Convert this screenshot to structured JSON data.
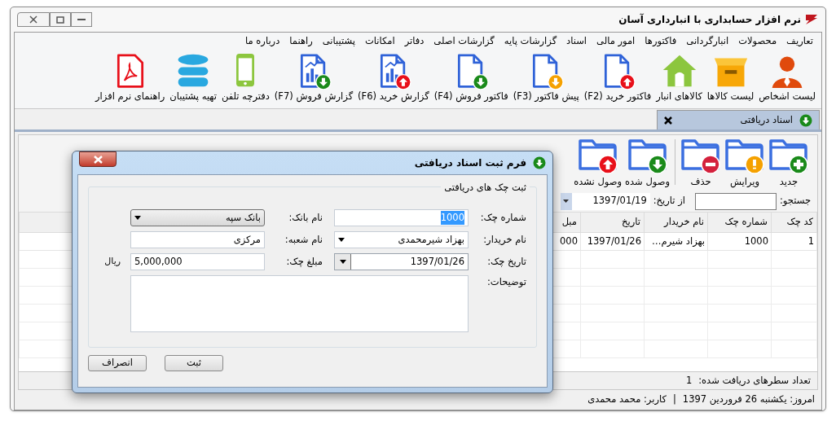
{
  "window": {
    "title": "نرم افزار حسابداری با انبارداری آسان"
  },
  "menu": [
    "تعاریف",
    "محصولات",
    "انبارگردانی",
    "فاکتورها",
    "امور مالی",
    "اسناد",
    "گزارشات پایه",
    "گزارشات اصلی",
    "دفاتر",
    "امکانات",
    "پشتیبانی",
    "راهنما",
    "درباره ما"
  ],
  "toolbar": [
    {
      "label": "لیست اشخاص",
      "kind": "person"
    },
    {
      "label": "لیست کالاها",
      "kind": "box"
    },
    {
      "label": "کالاهای انبار",
      "kind": "house"
    },
    {
      "label": "فاکتور خرید (F2)",
      "kind": "doc-up"
    },
    {
      "label": "پیش فاکتور (F3)",
      "kind": "doc-pending"
    },
    {
      "label": "فاکتور فروش (F4)",
      "kind": "doc-down"
    },
    {
      "label": "گزارش خرید (F6)",
      "kind": "chart-up"
    },
    {
      "label": "گزارش فروش (F7)",
      "kind": "chart-down"
    },
    {
      "label": "دفترچه تلفن",
      "kind": "phone"
    },
    {
      "label": "تهیه پشتیبان",
      "kind": "database"
    },
    {
      "label": "راهنمای نرم افزار",
      "kind": "pdf"
    }
  ],
  "tabs": [
    {
      "label": "اسناد دریافتی",
      "selected": true
    }
  ],
  "actions": [
    {
      "label": "جدید",
      "kind": "add"
    },
    {
      "label": "ویرایش",
      "kind": "edit"
    },
    {
      "label": "حذف",
      "kind": "delete"
    },
    {
      "label": "وصول شده",
      "kind": "received"
    },
    {
      "label": "وصول نشده",
      "kind": "unreceived"
    }
  ],
  "filter": {
    "search_label": "جستجو:",
    "from_label": "از تاریخ:",
    "from_date": "1397/01/19"
  },
  "table": {
    "columns": [
      "کد چک",
      "شماره چک",
      "نام خریدار",
      "تاریخ",
      "مبل"
    ],
    "rows": [
      [
        "1",
        "1000",
        "بهزاد شیرم…",
        "1397/01/26",
        "000"
      ]
    ]
  },
  "row_count": {
    "label": "تعداد سطرهای دریافت شده:",
    "value": "1"
  },
  "status_bar": {
    "date": "امروز: یکشنبه 26 فروردین 1397",
    "separator": "|",
    "user": "کاربر: محمد محمدی"
  },
  "dialog": {
    "title": "فرم ثبت اسناد دریافتی",
    "group": "ثبت چک های دریافتی",
    "fields": [
      {
        "label": "شماره چک:",
        "value": "1000",
        "kind": "text",
        "highlighted": true
      },
      {
        "label": "نام بانک:",
        "value": "بانک سپه",
        "kind": "dropdown"
      },
      {
        "label": "نام خریدار:",
        "value": "بهزاد شیرمحمدی",
        "kind": "combo"
      },
      {
        "label": "نام شعبه:",
        "value": "مرکزی",
        "kind": "text"
      },
      {
        "label": "تاریخ چک:",
        "value": "1397/01/26",
        "kind": "date"
      },
      {
        "label": "مبلغ چک:",
        "value": "5,000,000",
        "kind": "amount",
        "suffix": "ریال"
      },
      {
        "label": "توضیحات:",
        "kind": "textarea"
      }
    ],
    "buttons": [
      "ثبت",
      "انصراف"
    ]
  }
}
